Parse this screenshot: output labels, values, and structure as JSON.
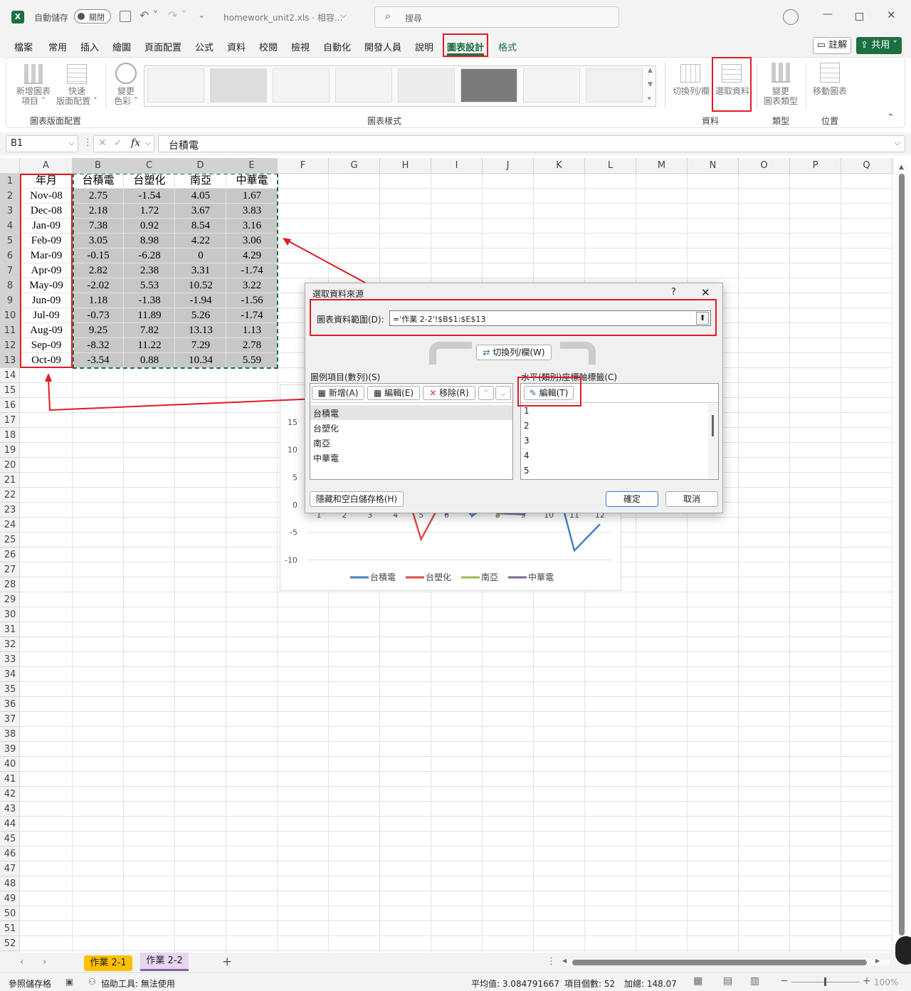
{
  "title": {
    "autosave": "自動儲存",
    "toggle": "關閉",
    "filename": "homework_unit2.xls · 相容...",
    "search": "搜尋"
  },
  "menu": [
    "檔案",
    "常用",
    "插入",
    "繪圖",
    "頁面配置",
    "公式",
    "資料",
    "校閱",
    "檢視",
    "自動化",
    "開發人員",
    "說明",
    "圖表設計",
    "格式"
  ],
  "actions": {
    "comment": "註解",
    "share": "共用"
  },
  "ribbon": {
    "add_element": [
      "新增圖表",
      "項目"
    ],
    "quick_layout": [
      "快速",
      "版面配置"
    ],
    "change_color": [
      "變更",
      "色彩"
    ],
    "switch": "切換列/欄",
    "select_data": "選取資料",
    "change_type": [
      "變更",
      "圖表類型"
    ],
    "move_chart": "移動圖表",
    "groups": {
      "layout": "圖表版面配置",
      "styles": "圖表樣式",
      "data": "資料",
      "type": "類型",
      "location": "位置"
    }
  },
  "formula": {
    "namebox": "B1",
    "fx": "fx",
    "content": "台積電"
  },
  "columns": [
    "A",
    "B",
    "C",
    "D",
    "E",
    "F",
    "G",
    "H",
    "I",
    "J",
    "K",
    "L",
    "M",
    "N",
    "O",
    "P",
    "Q"
  ],
  "headers": [
    "年月",
    "台積電",
    "台塑化",
    "南亞",
    "中華電"
  ],
  "rows": [
    [
      "Nov-08",
      "2.75",
      "-1.54",
      "4.05",
      "1.67"
    ],
    [
      "Dec-08",
      "2.18",
      "1.72",
      "3.67",
      "3.83"
    ],
    [
      "Jan-09",
      "7.38",
      "0.92",
      "8.54",
      "3.16"
    ],
    [
      "Feb-09",
      "3.05",
      "8.98",
      "4.22",
      "3.06"
    ],
    [
      "Mar-09",
      "-0.15",
      "-6.28",
      "0",
      "4.29"
    ],
    [
      "Apr-09",
      "2.82",
      "2.38",
      "3.31",
      "-1.74"
    ],
    [
      "May-09",
      "-2.02",
      "5.53",
      "10.52",
      "3.22"
    ],
    [
      "Jun-09",
      "1.18",
      "-1.38",
      "-1.94",
      "-1.56"
    ],
    [
      "Jul-09",
      "-0.73",
      "11.89",
      "5.26",
      "-1.74"
    ],
    [
      "Aug-09",
      "9.25",
      "7.82",
      "13.13",
      "1.13"
    ],
    [
      "Sep-09",
      "-8.32",
      "11.22",
      "7.29",
      "2.78"
    ],
    [
      "Oct-09",
      "-3.54",
      "0.88",
      "10.34",
      "5.59"
    ]
  ],
  "chart": {
    "yticks": [
      "15",
      "10",
      "5",
      "0",
      "-5",
      "-10"
    ],
    "xticks": [
      "1",
      "2",
      "3",
      "4",
      "5",
      "6",
      "7",
      "8",
      "9",
      "10",
      "11",
      "12"
    ],
    "legend": [
      {
        "name": "台積電",
        "color": "#4a7fc1"
      },
      {
        "name": "台塑化",
        "color": "#d94b4b"
      },
      {
        "name": "南亞",
        "color": "#9bbb59"
      },
      {
        "name": "中華電",
        "color": "#8064a2"
      }
    ]
  },
  "dialog": {
    "title": "選取資料來源",
    "help": "?",
    "range_label": "圖表資料範圍(D):",
    "range_value": "='作業 2-2'!$B$1:$E$13",
    "switch_btn": "切換列/欄(W)",
    "legend_label": "圖例項目(數列)(S)",
    "add": "新增(A)",
    "edit": "編輯(E)",
    "remove": "移除(R)",
    "axis_label": "水平(類別)座標軸標籤(C)",
    "axis_edit": "編輯(T)",
    "series": [
      "台積電",
      "台塑化",
      "南亞",
      "中華電"
    ],
    "axis_items": [
      "1",
      "2",
      "3",
      "4",
      "5"
    ],
    "hidden_btn": "隱藏和空白儲存格(H)",
    "ok": "確定",
    "cancel": "取消"
  },
  "sheets": [
    "作業 2-1",
    "作業 2-2"
  ],
  "status": {
    "mode": "參照儲存格",
    "accessibility": "協助工具: 無法使用",
    "average": "平均值: 3.084791667",
    "count": "項目個數: 52",
    "sum": "加總: 148.07",
    "zoom": "100%"
  }
}
